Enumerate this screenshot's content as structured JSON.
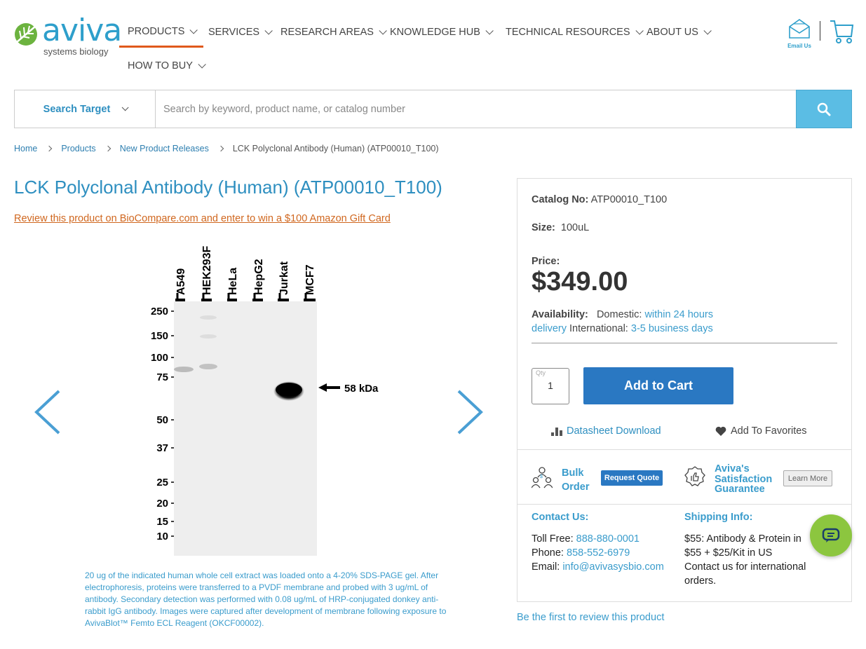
{
  "brand": {
    "name": "aviva",
    "tagline": "systems biology",
    "colors": {
      "primary": "#2e9fcb",
      "accent": "#e0591b",
      "button": "#2a78c2",
      "chat": "#8cc63f"
    }
  },
  "nav": {
    "items": [
      {
        "label": "PRODUCTS",
        "active": true
      },
      {
        "label": "SERVICES"
      },
      {
        "label": "RESEARCH AREAS"
      },
      {
        "label": "KNOWLEDGE HUB"
      },
      {
        "label": "TECHNICAL RESOURCES"
      },
      {
        "label": "ABOUT US"
      },
      {
        "label": "HOW TO BUY"
      }
    ],
    "email_label": "Email Us"
  },
  "search": {
    "target_label": "Search Target",
    "placeholder": "Search by keyword, product name, or catalog number"
  },
  "breadcrumb": {
    "home": "Home",
    "products": "Products",
    "new_releases": "New Product Releases",
    "current": "LCK Polyclonal Antibody (Human) (ATP00010_T100)"
  },
  "product": {
    "title": "LCK Polyclonal Antibody (Human) (ATP00010_T100)",
    "promo": "Review this product on BioCompare.com and enter to win a $100 Amazon Gift Card",
    "caption": "20 ug of the indicated human whole cell extract was loaded onto a 4-20% SDS-PAGE gel. After electrophoresis, proteins were transferred to a PVDF membrane and probed with 3 ug/mL of antibody. Secondary detection was performed with 0.08 ug/mL of HRP-conjugated donkey anti-rabbit IgG antibody. Images were captured after development of membrane following exposure to AvivaBlot™ Femto ECL Reagent (OKCF00002).",
    "blot": {
      "lanes": [
        "A549",
        "HEK293F",
        "HeLa",
        "HepG2",
        "Jurkat",
        "MCF7"
      ],
      "markers": [
        "250",
        "150",
        "100",
        "75",
        "50",
        "37",
        "25",
        "20",
        "15",
        "10"
      ],
      "band_label": "58 kDa"
    }
  },
  "purchase": {
    "catalog_label": "Catalog No:",
    "catalog_value": "ATP00010_T100",
    "size_label": "Size:",
    "size_value": "100uL",
    "price_label": "Price:",
    "price": "$349.00",
    "availability_label": "Availability:",
    "domestic_label": "Domestic:",
    "domestic_value_a": "within 24 hours",
    "domestic_value_b": "delivery",
    "international_label": "International:",
    "international_value": "3-5 business days",
    "qty_label": "Qty",
    "qty_value": "1",
    "add_to_cart": "Add to Cart",
    "datasheet": "Datasheet Download",
    "favorites": "Add To Favorites",
    "bulk_line1": "Bulk",
    "bulk_line2": "Order",
    "request_quote": "Request Quote",
    "sat_line1": "Aviva's",
    "sat_line2": "Satisfaction",
    "sat_line3": "Guarantee",
    "learn_more": "Learn More"
  },
  "contact": {
    "heading": "Contact Us:",
    "toll_free_label": "Toll Free:",
    "toll_free": "888-880-0001",
    "phone_label": "Phone:",
    "phone": "858-552-6979",
    "email_label": "Email:",
    "email": "info@avivasysbio.com"
  },
  "shipping": {
    "heading": "Shipping Info:",
    "line1": "$55: Antibody & Protein in",
    "line2": "$55 + $25/Kit in US",
    "line3": "Contact us for international orders."
  },
  "review_link": "Be the first to review this product"
}
